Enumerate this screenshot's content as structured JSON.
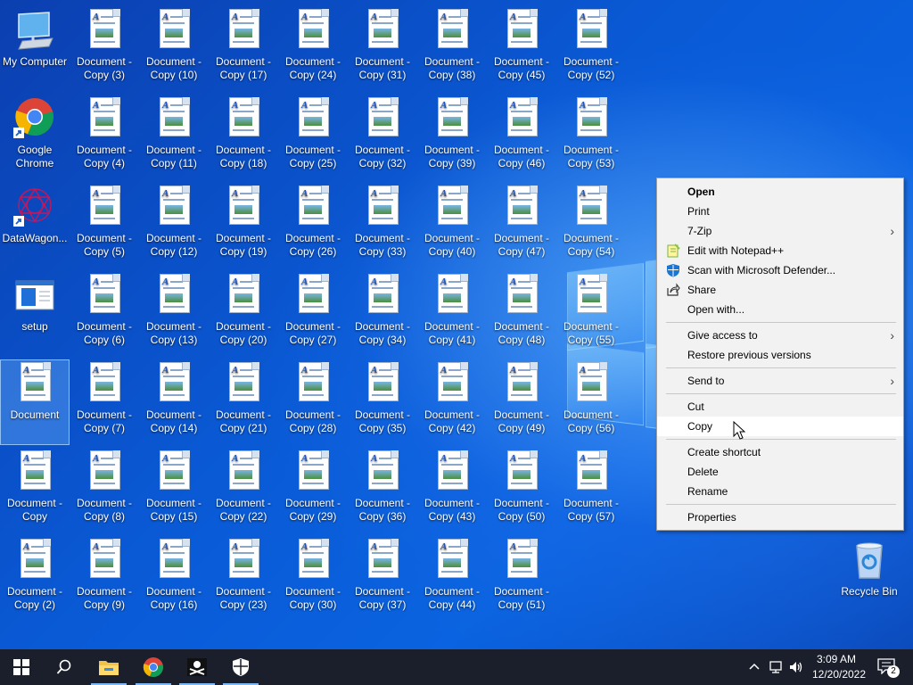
{
  "desktop": {
    "system_icons": [
      {
        "name": "my-computer-icon",
        "label": "My Computer"
      },
      {
        "name": "google-chrome-shortcut-icon",
        "label": "Google Chrome"
      },
      {
        "name": "datawagon-shortcut-icon",
        "label": "DataWagon..."
      },
      {
        "name": "setup-icon",
        "label": "setup"
      },
      {
        "name": "document-icon",
        "label": "Document"
      },
      {
        "name": "document-copy-icon",
        "label": "Document - Copy"
      },
      {
        "name": "document-copy-2-icon",
        "label": "Document - Copy (2)"
      }
    ],
    "document_columns": [
      [
        "Document - Copy (3)",
        "Document - Copy (4)",
        "Document - Copy (5)",
        "Document - Copy (6)",
        "Document - Copy (7)",
        "Document - Copy (8)",
        "Document - Copy (9)"
      ],
      [
        "Document - Copy (10)",
        "Document - Copy (11)",
        "Document - Copy (12)",
        "Document - Copy (13)",
        "Document - Copy (14)",
        "Document - Copy (15)",
        "Document - Copy (16)"
      ],
      [
        "Document - Copy (17)",
        "Document - Copy (18)",
        "Document - Copy (19)",
        "Document - Copy (20)",
        "Document - Copy (21)",
        "Document - Copy (22)",
        "Document - Copy (23)"
      ],
      [
        "Document - Copy (24)",
        "Document - Copy (25)",
        "Document - Copy (26)",
        "Document - Copy (27)",
        "Document - Copy (28)",
        "Document - Copy (29)",
        "Document - Copy (30)"
      ],
      [
        "Document - Copy (31)",
        "Document - Copy (32)",
        "Document - Copy (33)",
        "Document - Copy (34)",
        "Document - Copy (35)",
        "Document - Copy (36)",
        "Document - Copy (37)"
      ],
      [
        "Document - Copy (38)",
        "Document - Copy (39)",
        "Document - Copy (40)",
        "Document - Copy (41)",
        "Document - Copy (42)",
        "Document - Copy (43)",
        "Document - Copy (44)"
      ],
      [
        "Document - Copy (45)",
        "Document - Copy (46)",
        "Document - Copy (47)",
        "Document - Copy (48)",
        "Document - Copy (49)",
        "Document - Copy (50)",
        "Document - Copy (51)"
      ],
      [
        "Document - Copy (52)",
        "Document - Copy (53)",
        "Document - Copy (54)",
        "Document - Copy (55)",
        "Document - Copy (56)",
        "Document - Copy (57)"
      ]
    ],
    "doc_icon_letter": "A",
    "recycle_bin_label": "Recycle Bin",
    "selected_icon": "Document"
  },
  "context_menu": {
    "items": [
      {
        "label": "Open",
        "bold": true
      },
      {
        "label": "Print"
      },
      {
        "label": "7-Zip",
        "submenu": true
      },
      {
        "label": "Edit with Notepad++",
        "icon": "notepad-plus-plus-icon"
      },
      {
        "label": "Scan with Microsoft Defender...",
        "icon": "defender-shield-icon"
      },
      {
        "label": "Share",
        "icon": "share-icon"
      },
      {
        "label": "Open with..."
      },
      {
        "separator": true
      },
      {
        "label": "Give access to",
        "submenu": true
      },
      {
        "label": "Restore previous versions"
      },
      {
        "separator": true
      },
      {
        "label": "Send to",
        "submenu": true
      },
      {
        "separator": true
      },
      {
        "label": "Cut"
      },
      {
        "label": "Copy",
        "hover": true
      },
      {
        "separator": true
      },
      {
        "label": "Create shortcut"
      },
      {
        "label": "Delete"
      },
      {
        "label": "Rename"
      },
      {
        "separator": true
      },
      {
        "label": "Properties"
      }
    ],
    "submenu_arrow": "›"
  },
  "taskbar": {
    "buttons": [
      {
        "name": "start-button",
        "icon": "windows-logo-icon"
      },
      {
        "name": "search-button",
        "icon": "search-icon"
      },
      {
        "name": "file-explorer-button",
        "icon": "folder-icon"
      },
      {
        "name": "chrome-taskbar-button",
        "icon": "chrome-icon"
      },
      {
        "name": "pirate-app-taskbar-button",
        "icon": "pirate-flag-icon"
      },
      {
        "name": "windows-security-taskbar-button",
        "icon": "shield-icon"
      }
    ],
    "tray": {
      "time": "3:09 AM",
      "date": "12/20/2022",
      "notification_count": "2"
    }
  },
  "colors": {
    "taskbar_bg": "#1a1f2b",
    "menu_bg": "#f2f2f2",
    "active_indicator": "#7cb8f5",
    "desktop_blue": "#0a54c9"
  }
}
